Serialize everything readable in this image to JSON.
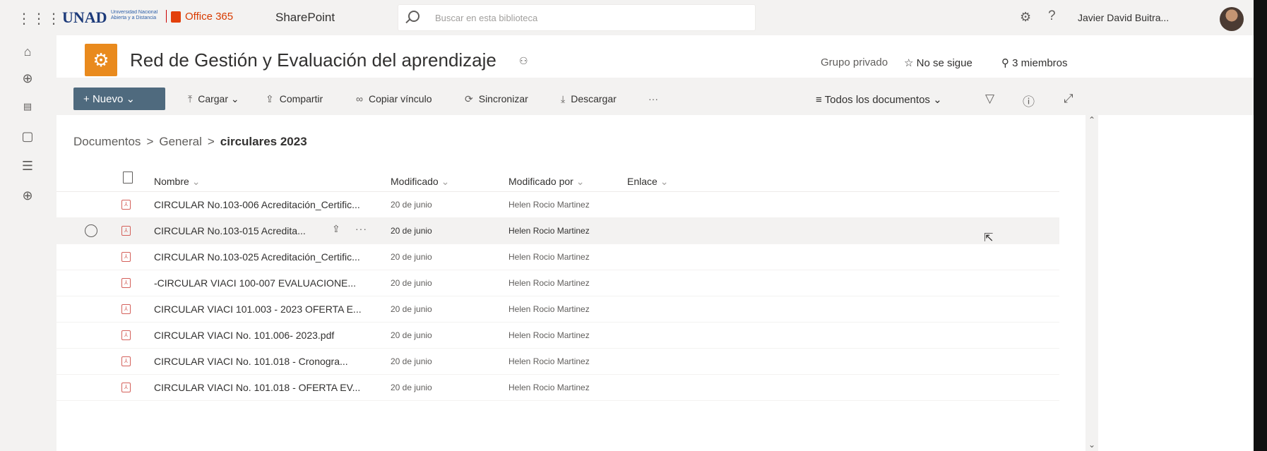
{
  "suitebar": {
    "logo_text": "UNAD",
    "logo_sub": "Universidad Nacional Abierta y a Distancia",
    "office_label": "Office 365",
    "app_name": "SharePoint",
    "search_placeholder": "Buscar en esta biblioteca",
    "user_name": "Javier David Buitra...",
    "icons": [
      "waffle-icon",
      "search-icon",
      "gear-icon",
      "help-icon",
      "avatar"
    ]
  },
  "leftrail": {
    "icons": [
      "home-icon",
      "globe-icon",
      "news-icon",
      "file-icon",
      "list-icon",
      "add-icon"
    ]
  },
  "site": {
    "title": "Red de Gestión y Evaluación del aprendizaje",
    "privacy": "Grupo privado",
    "follow_label": "No se sigue",
    "members_label": "3 miembros"
  },
  "commandbar": {
    "new_label": "Nuevo",
    "upload_label": "Cargar",
    "share_label": "Compartir",
    "copy_link_label": "Copiar vínculo",
    "sync_label": "Sincronizar",
    "download_label": "Descargar",
    "more_label": "···",
    "view_label": "Todos los documentos"
  },
  "breadcrumb": {
    "items": [
      "Documentos",
      "General"
    ],
    "current": "circulares 2023",
    "separator": ">"
  },
  "table": {
    "columns": [
      "Nombre",
      "Modificado",
      "Modificado por",
      "Enlace"
    ],
    "rows": [
      {
        "name": "CIRCULAR No.103-006 Acreditación_Certific...",
        "modified": "20 de junio",
        "modified_by": "Helen Rocio Martinez"
      },
      {
        "name": "CIRCULAR No.103-015 Acredita...",
        "modified": "20 de junio",
        "modified_by": "Helen Rocio Martinez"
      },
      {
        "name": "CIRCULAR No.103-025 Acreditación_Certific...",
        "modified": "20 de junio",
        "modified_by": "Helen Rocio Martinez"
      },
      {
        "name": "-CIRCULAR VIACI 100-007  EVALUACIONE...",
        "modified": "20 de junio",
        "modified_by": "Helen Rocio Martinez"
      },
      {
        "name": "CIRCULAR VIACI 101.003 - 2023  OFERTA E...",
        "modified": "20 de junio",
        "modified_by": "Helen Rocio Martinez"
      },
      {
        "name": "CIRCULAR VIACI No. 101.006- 2023.pdf",
        "modified": "20 de junio",
        "modified_by": "Helen Rocio Martinez"
      },
      {
        "name": "CIRCULAR VIACI No. 101.018 -  Cronogra...",
        "modified": "20 de junio",
        "modified_by": "Helen Rocio Martinez"
      },
      {
        "name": "CIRCULAR VIACI No. 101.018 - OFERTA EV...",
        "modified": "20 de junio",
        "modified_by": "Helen Rocio Martinez"
      }
    ],
    "selected_row": 1
  },
  "colors": {
    "accent_button": "#4f6a7e",
    "pdf_icon": "#d4605a",
    "office_brand": "#d83b01",
    "site_logo": "#e98a1d"
  }
}
